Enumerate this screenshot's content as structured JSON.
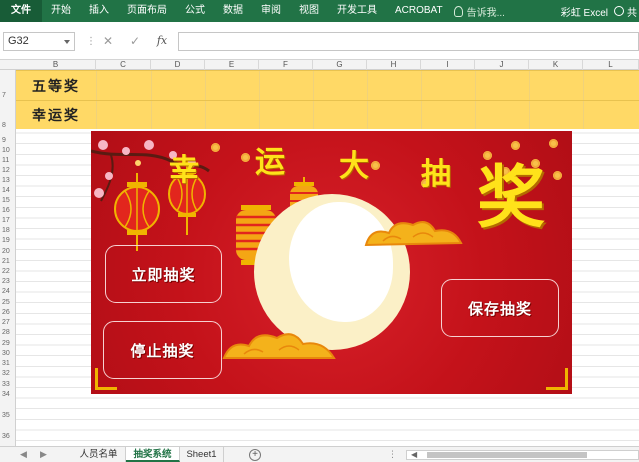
{
  "ribbon": {
    "tabs": [
      "文件",
      "开始",
      "插入",
      "页面布局",
      "公式",
      "数据",
      "审阅",
      "视图",
      "开发工具",
      "ACROBAT"
    ],
    "tell_me": "告诉我...",
    "user": "彩虹 Excel",
    "share": "共"
  },
  "formula_bar": {
    "name_box": "G32",
    "cancel_icon": "✕",
    "enter_icon": "✓",
    "fx_label": "fx",
    "formula": ""
  },
  "columns": [
    "B",
    "C",
    "D",
    "E",
    "F",
    "G",
    "H",
    "I",
    "J",
    "K",
    "L"
  ],
  "rows": [
    "7",
    "8",
    "9",
    "10",
    "11",
    "12",
    "13",
    "14",
    "15",
    "16",
    "17",
    "18",
    "19",
    "20",
    "21",
    "22",
    "23",
    "24",
    "25",
    "26",
    "27",
    "28",
    "29",
    "30",
    "31",
    "32",
    "33",
    "34",
    "35",
    "36"
  ],
  "cells": {
    "row7_label": "五等奖",
    "row8_label": "幸运奖"
  },
  "banner": {
    "title_chars": [
      "幸",
      "运",
      "大",
      "抽"
    ],
    "big_char": "奖",
    "buttons": {
      "start": "立即抽奖",
      "stop": "停止抽奖",
      "save": "保存抽奖"
    },
    "colors": {
      "background": "#c8141c",
      "title": "#ffe21a",
      "moon": "#fbf0c7"
    }
  },
  "sheet_tabs": {
    "tabs": [
      "人员名单",
      "抽奖系统",
      "Sheet1"
    ],
    "active": "抽奖系统",
    "add_icon": "+"
  },
  "icons": {
    "tell_me": "lightbulb-icon",
    "share": "person-icon",
    "name_box_dropdown": "chevron-down-icon",
    "add_sheet": "plus-circle-icon"
  }
}
